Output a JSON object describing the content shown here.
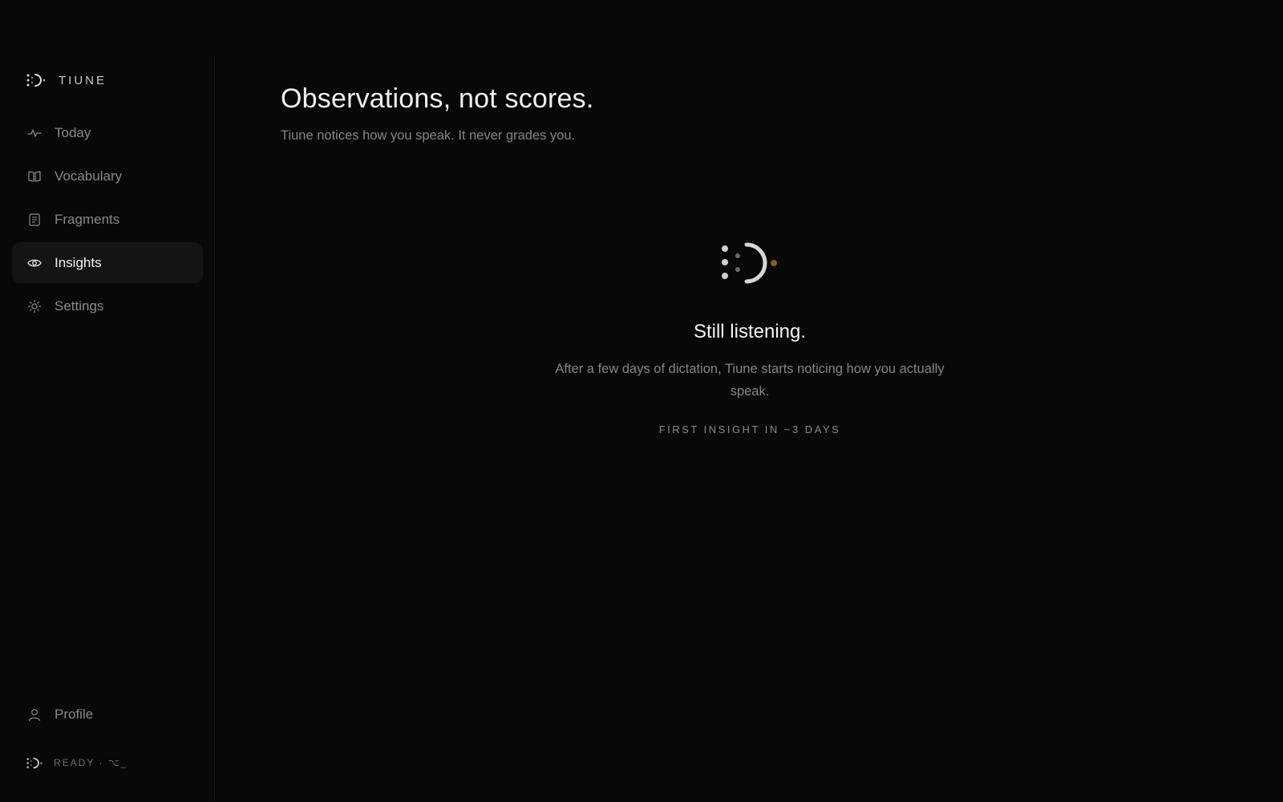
{
  "brand": {
    "name": "TIUNE",
    "logo_icon": "tiune-logo-icon",
    "accent_color": "#c58a1e"
  },
  "sidebar": {
    "items": [
      {
        "label": "Today",
        "icon": "activity-icon",
        "active": false
      },
      {
        "label": "Vocabulary",
        "icon": "book-icon",
        "active": false
      },
      {
        "label": "Fragments",
        "icon": "document-icon",
        "active": false
      },
      {
        "label": "Insights",
        "icon": "eye-icon",
        "active": true
      },
      {
        "label": "Settings",
        "icon": "sun-gear-icon",
        "active": false
      }
    ],
    "profile": {
      "label": "Profile",
      "icon": "user-icon"
    },
    "status": {
      "text": "READY · ⌥_",
      "icon": "tiune-logo-icon"
    }
  },
  "main": {
    "title": "Observations, not scores.",
    "subtitle": "Tiune notices how you speak. It never grades you.",
    "empty_state": {
      "icon": "tiune-logo-icon",
      "title": "Still listening.",
      "description": "After a few days of dictation, Tiune starts noticing how you actually speak.",
      "eta": "FIRST INSIGHT IN ~3 DAYS"
    }
  }
}
